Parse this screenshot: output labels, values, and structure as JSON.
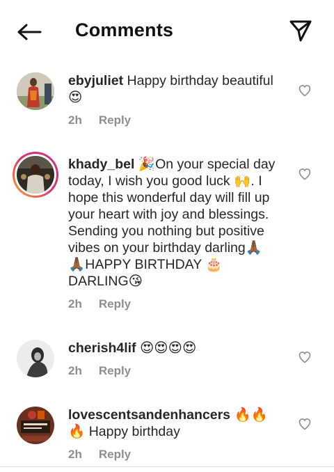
{
  "header": {
    "title": "Comments",
    "back_icon": "arrow-left-icon",
    "send_icon": "paper-plane-icon"
  },
  "comments": [
    {
      "username": "ebyjuliet",
      "text": " Happy birthday beautiful 😍",
      "time": "2h",
      "reply": "Reply"
    },
    {
      "username": "khady_bel",
      "text": " 🎉On your special day today, I wish you good luck 🙌. I hope this wonderful day will fill up your heart with joy and blessings. Sending you nothing but positive vibes on your birthday darling🙏🏾🙏🏾HAPPY BIRTHDAY 🎂 DARLING😘",
      "time": "2h",
      "reply": "Reply"
    },
    {
      "username": "cherish4lif",
      "text": " 😍😍😍😍",
      "time": "2h",
      "reply": "Reply"
    },
    {
      "username": "lovescentsandenhancers",
      "text": " 🔥🔥 🔥 Happy birthday",
      "time": "2h",
      "reply": "Reply"
    }
  ],
  "colors": {
    "text": "#262626",
    "meta": "#8e8e8e",
    "story_ring": "#e1306c"
  }
}
